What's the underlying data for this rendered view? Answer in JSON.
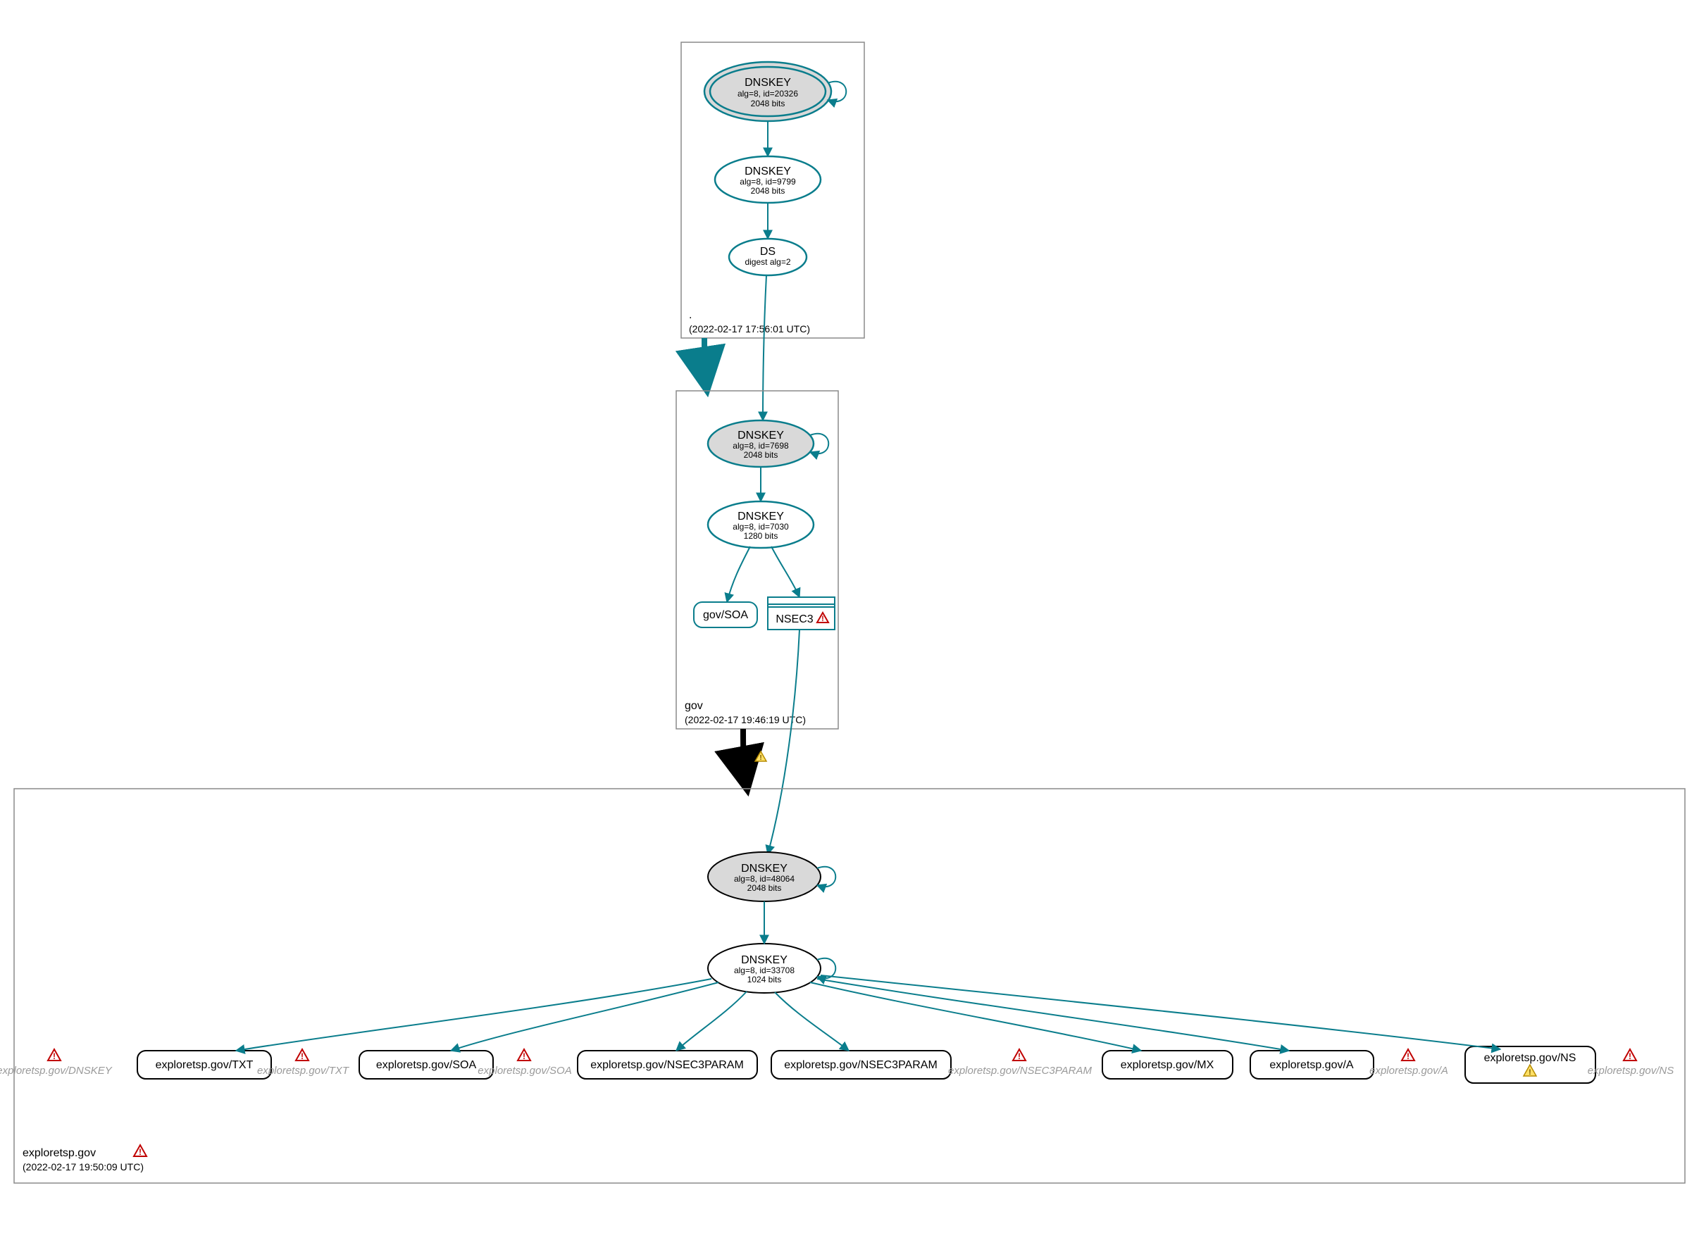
{
  "zones": {
    "root": {
      "label": ".",
      "timestamp": "(2022-02-17 17:56:01 UTC)"
    },
    "gov": {
      "label": "gov",
      "timestamp": "(2022-02-17 19:46:19 UTC)"
    },
    "exp": {
      "label": "exploretsp.gov",
      "timestamp": "(2022-02-17 19:50:09 UTC)"
    }
  },
  "nodes": {
    "root_ksk": {
      "title": "DNSKEY",
      "line1": "alg=8, id=20326",
      "line2": "2048 bits"
    },
    "root_zsk": {
      "title": "DNSKEY",
      "line1": "alg=8, id=9799",
      "line2": "2048 bits"
    },
    "root_ds": {
      "title": "DS",
      "line1": "digest alg=2"
    },
    "gov_ksk": {
      "title": "DNSKEY",
      "line1": "alg=8, id=7698",
      "line2": "2048 bits"
    },
    "gov_zsk": {
      "title": "DNSKEY",
      "line1": "alg=8, id=7030",
      "line2": "1280 bits"
    },
    "gov_soa": {
      "label": "gov/SOA"
    },
    "gov_nsec3": {
      "label": "NSEC3"
    },
    "exp_ksk": {
      "title": "DNSKEY",
      "line1": "alg=8, id=48064",
      "line2": "2048 bits"
    },
    "exp_zsk": {
      "title": "DNSKEY",
      "line1": "alg=8, id=33708",
      "line2": "1024 bits"
    }
  },
  "rr": {
    "txt": "exploretsp.gov/TXT",
    "soa": "exploretsp.gov/SOA",
    "nsec3a": "exploretsp.gov/NSEC3PARAM",
    "nsec3b": "exploretsp.gov/NSEC3PARAM",
    "mx": "exploretsp.gov/MX",
    "a": "exploretsp.gov/A",
    "ns": "exploretsp.gov/NS"
  },
  "ghost": {
    "dnskey": "exploretsp.gov/DNSKEY",
    "txt": "exploretsp.gov/TXT",
    "soa": "exploretsp.gov/SOA",
    "nsec3": "exploretsp.gov/NSEC3PARAM",
    "a": "exploretsp.gov/A",
    "ns": "exploretsp.gov/NS"
  },
  "colors": {
    "teal": "#0a7d8c",
    "box": "#8a8a8a",
    "grey": "#d9d9d9",
    "ghost": "#9a9a9a",
    "red": "#c00000",
    "yellowFill": "#ffe066",
    "yellowStroke": "#b58b00"
  }
}
